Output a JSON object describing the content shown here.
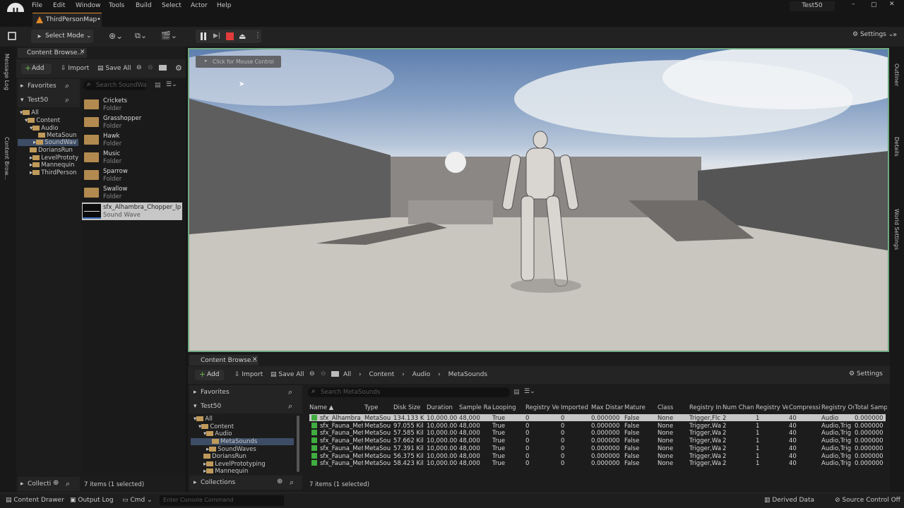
{
  "menu": {
    "items": [
      "File",
      "Edit",
      "Window",
      "Tools",
      "Build",
      "Select",
      "Actor",
      "Help"
    ],
    "project": "Test50"
  },
  "map_tab": "ThirdPersonMap•",
  "toolbar": {
    "select_mode": "Select Mode",
    "settings": "Settings"
  },
  "side_left": {
    "message_log": "Message Log",
    "content_browser": "Content Brow..."
  },
  "side_right": {
    "outliner": "Outliner",
    "details": "Details",
    "world_settings": "World Settings"
  },
  "cb_left": {
    "tab": "Content Browse...",
    "add": "Add",
    "import": "Import",
    "save_all": "Save All",
    "favorites": "Favorites",
    "project": "Test50",
    "search_placeholder": "Search SoundWa",
    "tree": [
      "All",
      "Content",
      "Audio",
      "MetaSoun",
      "SoundWav",
      "DoriansRun",
      "LevelPrototy",
      "Mannequin",
      "ThirdPerson"
    ],
    "items": [
      {
        "name": "Crickets",
        "type": "Folder"
      },
      {
        "name": "Grasshopper",
        "type": "Folder"
      },
      {
        "name": "Hawk",
        "type": "Folder"
      },
      {
        "name": "Music",
        "type": "Folder"
      },
      {
        "name": "Sparrow",
        "type": "Folder"
      },
      {
        "name": "Swallow",
        "type": "Folder"
      },
      {
        "name": "sfx_Alhambra_Chopper_lp",
        "type": "Sound Wave"
      }
    ],
    "status": "7 items (1 selected)",
    "collections": "Collecti"
  },
  "viewport": {
    "hint": "Click for Mouse Control"
  },
  "cb_bottom": {
    "tab": "Content Browse...",
    "add": "Add",
    "import": "Import",
    "save_all": "Save All",
    "breadcrumb": [
      "All",
      "Content",
      "Audio",
      "MetaSounds"
    ],
    "settings": "Settings",
    "favorites": "Favorites",
    "project": "Test50",
    "search_placeholder": "Search MetaSounds",
    "tree": [
      "All",
      "Content",
      "Audio",
      "MetaSounds",
      "SoundWaves",
      "DoriansRun",
      "LevelPrototyping",
      "Mannequin"
    ],
    "collections": "Collections",
    "status": "7 items (1 selected)",
    "columns": [
      "Name ▲",
      "Type",
      "Disk Size",
      "Duration",
      "Sample Ra",
      "Looping",
      "Registry Ve",
      "Imported S",
      "Max Distar",
      "Mature",
      "Class",
      "Registry In",
      "Num Chan",
      "Registry Ve",
      "Compressi",
      "Registry Ou",
      "Total Samp"
    ],
    "rows": [
      [
        "sfx_Alhambra_(",
        "MetaSou",
        "134.133 K",
        "10,000.00",
        "48,000",
        "True",
        "0",
        "0",
        "0.000000",
        "False",
        "None",
        "Trigger,Flc",
        "2",
        "1",
        "40",
        "Audio",
        "0.000000"
      ],
      [
        "sfx_Fauna_Met",
        "MetaSou",
        "97.055 Kil",
        "10,000.00",
        "48,000",
        "True",
        "0",
        "0",
        "0.000000",
        "False",
        "None",
        "Trigger,Wa",
        "2",
        "1",
        "40",
        "Audio,Trig",
        "0.000000"
      ],
      [
        "sfx_Fauna_Met",
        "MetaSou",
        "57.585 Kil",
        "10,000.00",
        "48,000",
        "True",
        "0",
        "0",
        "0.000000",
        "False",
        "None",
        "Trigger,Wa",
        "2",
        "1",
        "40",
        "Audio,Trig",
        "0.000000"
      ],
      [
        "sfx_Fauna_Met",
        "MetaSou",
        "57.662 Kil",
        "10,000.00",
        "48,000",
        "True",
        "0",
        "0",
        "0.000000",
        "False",
        "None",
        "Trigger,Wa",
        "2",
        "1",
        "40",
        "Audio,Trig",
        "0.000000"
      ],
      [
        "sfx_Fauna_Met",
        "MetaSou",
        "57.391 Kil",
        "10,000.00",
        "48,000",
        "True",
        "0",
        "0",
        "0.000000",
        "False",
        "None",
        "Trigger,Wa",
        "2",
        "1",
        "40",
        "Audio,Trig",
        "0.000000"
      ],
      [
        "sfx_Fauna_Met",
        "MetaSou",
        "56.375 Kil",
        "10,000.00",
        "48,000",
        "True",
        "0",
        "0",
        "0.000000",
        "False",
        "None",
        "Trigger,Wa",
        "2",
        "1",
        "40",
        "Audio,Trig",
        "0.000000"
      ],
      [
        "sfx_Fauna_Met",
        "MetaSou",
        "58.423 Kil",
        "10,000.00",
        "48,000",
        "True",
        "0",
        "0",
        "0.000000",
        "False",
        "None",
        "Trigger,Wa",
        "2",
        "1",
        "40",
        "Audio,Trig",
        "0.000000"
      ]
    ]
  },
  "statusbar": {
    "content_drawer": "Content Drawer",
    "output_log": "Output Log",
    "cmd": "Cmd",
    "console_placeholder": "Enter Console Command",
    "derived_data": "Derived Data",
    "source_control": "Source Control Off"
  },
  "colors": {
    "accent_green": "#6fa87f",
    "tab_orange": "#e08a2a",
    "stop_red": "#e23b3b",
    "selection": "#3d4d66"
  }
}
